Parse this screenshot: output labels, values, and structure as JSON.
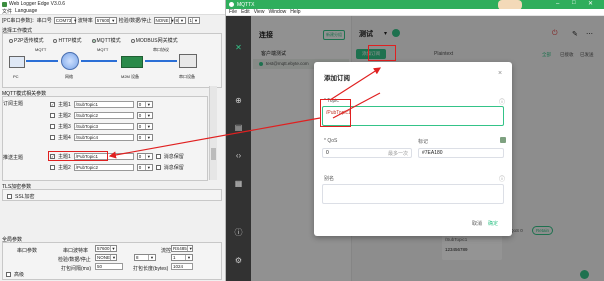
{
  "left_app": {
    "title": "Web Logger Edge V3.0.6",
    "menu": [
      "文件",
      "Language"
    ],
    "toolbar": {
      "port_label": "[PC串口参数]：串口号",
      "port_value": "COM73",
      "baud_label": "波特率",
      "baud_value": "57600",
      "parity_label": "检验/数据/停止",
      "parity_value": "NONE",
      "databits_value": "8",
      "stopbits_value": "1"
    },
    "work_mode": {
      "title": "选择工作模式",
      "options": [
        {
          "label": "P2P透传模式",
          "selected": false
        },
        {
          "label": "HTTP模式",
          "selected": false
        },
        {
          "label": "MQTT模式",
          "selected": true
        },
        {
          "label": "MODBUS网关模式",
          "selected": false
        }
      ],
      "diagram_labels": [
        "MQTT",
        "MQTT",
        "串口协议",
        "PC",
        "网络",
        "M2M 设备",
        "串口设备"
      ]
    },
    "mqtt_params_title": "MQTT模式相关参数",
    "subscribe": {
      "label": "订阅主题",
      "rows": [
        {
          "name": "主题1",
          "topic": "/SubTopic1",
          "qos": "0"
        },
        {
          "name": "主题2",
          "topic": "/SubTopic2",
          "qos": "0"
        },
        {
          "name": "主题3",
          "topic": "/SubTopic3",
          "qos": "0"
        },
        {
          "name": "主题4",
          "topic": "/SubTopic4",
          "qos": "0"
        }
      ]
    },
    "publish": {
      "label": "推送主题",
      "rows": [
        {
          "name": "主题1",
          "topic": "/PubTopic1",
          "qos": "0",
          "retain": "消息保留"
        },
        {
          "name": "主题2",
          "topic": "/PubTopic2",
          "qos": "0",
          "retain": "消息保留"
        }
      ]
    },
    "tls": {
      "title": "TLS加密参数",
      "ssl_label": "SSL加密"
    },
    "global": {
      "title": "全局参数",
      "port_params_label": "串口参数",
      "baud_label": "串口波特率",
      "baud_value": "57600",
      "parity_label": "检验/数据/停止",
      "parity_value": "NONE",
      "data_value": "8",
      "stop_value": "1",
      "flow_label": "流控",
      "flow_value": "RS485",
      "pack_interval_label": "打包间隔(ms)",
      "pack_interval_value": "50",
      "pack_length_label": "打包长度(bytes)",
      "pack_length_value": "1024",
      "advanced_label": "高级"
    }
  },
  "mqttx": {
    "window_title": "MQTTX",
    "menu": [
      "File",
      "Edit",
      "View",
      "Window",
      "Help"
    ],
    "connections_title": "连接",
    "new_button": "新建分组",
    "connection_item": "客户端测试",
    "connection_sub": "test@mqtt.ebyte.com",
    "tab_title": "测试",
    "add_subscription": "添加订阅",
    "payload_label": "Plaintext",
    "filters": [
      "全部",
      "已接收",
      "已发送"
    ],
    "message_topic": "/SubTopic1",
    "message_payload": "123456789",
    "message_qos": "QoS 0",
    "retain_label": "Retain",
    "dialog": {
      "title": "添加订阅",
      "topic_label": "* Topic",
      "topic_value": "/PubTopic1",
      "qos_label": "* QoS",
      "qos_value": "0",
      "qos_desc": "最多一次",
      "color_label": "标记",
      "color_value": "#7EA180",
      "alias_label": "别名",
      "cancel": "取消",
      "confirm": "确定"
    }
  },
  "colors": {
    "accent": "#34c388",
    "titlebar": "#2fae5c",
    "sidebar": "#323232",
    "highlight": "#e02020"
  }
}
